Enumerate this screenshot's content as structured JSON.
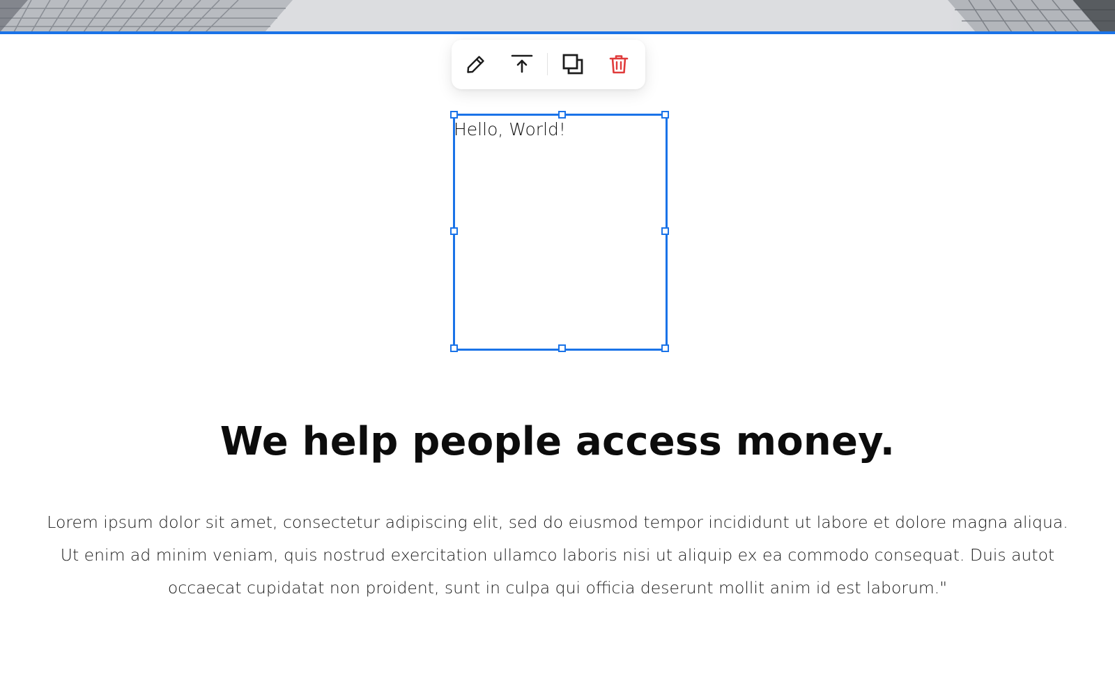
{
  "banner": {
    "image_description_icon": "building-photo"
  },
  "toolbar": {
    "buttons": [
      {
        "icon": "pencil-icon",
        "action": "edit"
      },
      {
        "icon": "arrow-up-to-line-icon",
        "action": "move-to-top"
      },
      {
        "icon": "duplicate-icon",
        "action": "duplicate"
      },
      {
        "icon": "trash-icon",
        "action": "delete"
      }
    ],
    "delete_color": "#e03b3b"
  },
  "textbox": {
    "text": "Hello, World!"
  },
  "content": {
    "headline": "We help people access money.",
    "paragraph": "Lorem ipsum dolor sit amet, consectetur adipiscing elit, sed do eiusmod tempor incididunt ut labore et dolore magna aliqua. Ut enim ad minim veniam, quis nostrud exercitation ullamco laboris nisi ut aliquip ex ea commodo consequat. Duis autot occaecat cupidatat non proident, sunt in culpa qui officia deserunt mollit anim id est laborum.\""
  },
  "colors": {
    "selection_accent": "#1a73e8",
    "delete_red": "#e03b3b",
    "text": "#111111"
  }
}
